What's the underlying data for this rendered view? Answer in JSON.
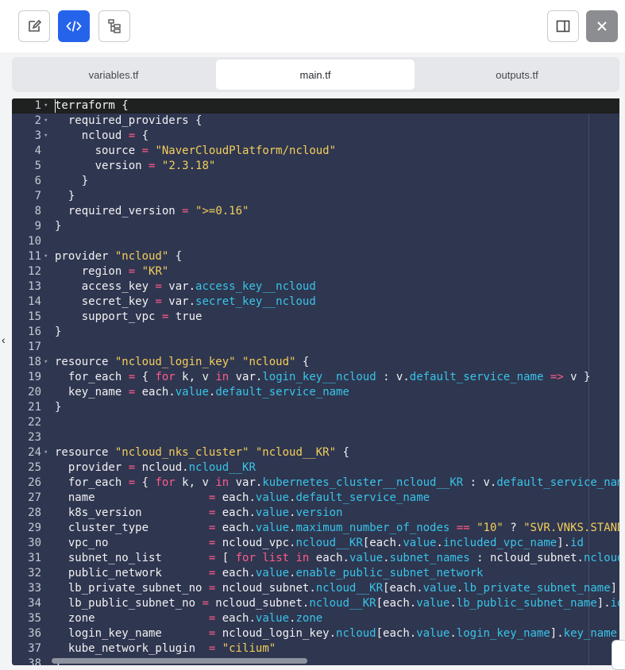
{
  "toolbar": {
    "buttons": [
      {
        "name": "edit-button",
        "icon": "edit-icon"
      },
      {
        "name": "code-view-button",
        "icon": "code-icon",
        "active": true
      },
      {
        "name": "tree-view-button",
        "icon": "tree-icon"
      }
    ],
    "right_buttons": [
      {
        "name": "toggle-panel-button",
        "icon": "sidebar-panel-icon"
      },
      {
        "name": "close-button",
        "icon": "close-icon"
      }
    ]
  },
  "tabs": [
    "variables.tf",
    "main.tf",
    "outputs.tf"
  ],
  "active_tab": "main.tf",
  "colors": {
    "accent": "#2563eb",
    "editor_bg": "#2f3650",
    "keyword": "#ff5c8a",
    "string": "#f2cf5b",
    "property": "#38c4e8"
  },
  "editor": {
    "lines": [
      {
        "n": "1",
        "fold": true,
        "tokens": [
          [
            "t",
            "terraform {"
          ]
        ]
      },
      {
        "n": "2",
        "fold": true,
        "tokens": [
          [
            "t",
            "  required_providers {"
          ]
        ]
      },
      {
        "n": "3",
        "fold": true,
        "tokens": [
          [
            "t",
            "    ncloud "
          ],
          [
            "k",
            "="
          ],
          [
            "t",
            " {"
          ]
        ]
      },
      {
        "n": "4",
        "tokens": [
          [
            "t",
            "      source "
          ],
          [
            "k",
            "="
          ],
          [
            "t",
            " "
          ],
          [
            "s",
            "\"NaverCloudPlatform/ncloud\""
          ]
        ]
      },
      {
        "n": "5",
        "tokens": [
          [
            "t",
            "      version "
          ],
          [
            "k",
            "="
          ],
          [
            "t",
            " "
          ],
          [
            "s",
            "\"2.3.18\""
          ]
        ]
      },
      {
        "n": "6",
        "tokens": [
          [
            "t",
            "    }"
          ]
        ]
      },
      {
        "n": "7",
        "tokens": [
          [
            "t",
            "  }"
          ]
        ]
      },
      {
        "n": "8",
        "tokens": [
          [
            "t",
            "  required_version "
          ],
          [
            "k",
            "="
          ],
          [
            "t",
            " "
          ],
          [
            "s",
            "\">=0.16\""
          ]
        ]
      },
      {
        "n": "9",
        "tokens": [
          [
            "t",
            "}"
          ]
        ]
      },
      {
        "n": "10",
        "tokens": [
          [
            "t",
            ""
          ]
        ]
      },
      {
        "n": "11",
        "fold": true,
        "tokens": [
          [
            "t",
            "provider "
          ],
          [
            "s",
            "\"ncloud\""
          ],
          [
            "t",
            " {"
          ]
        ]
      },
      {
        "n": "12",
        "tokens": [
          [
            "t",
            "    region "
          ],
          [
            "k",
            "="
          ],
          [
            "t",
            " "
          ],
          [
            "s",
            "\"KR\""
          ]
        ]
      },
      {
        "n": "13",
        "tokens": [
          [
            "t",
            "    access_key "
          ],
          [
            "k",
            "="
          ],
          [
            "t",
            " var."
          ],
          [
            "p",
            "access_key__ncloud"
          ]
        ]
      },
      {
        "n": "14",
        "tokens": [
          [
            "t",
            "    secret_key "
          ],
          [
            "k",
            "="
          ],
          [
            "t",
            " var."
          ],
          [
            "p",
            "secret_key__ncloud"
          ]
        ]
      },
      {
        "n": "15",
        "tokens": [
          [
            "t",
            "    support_vpc "
          ],
          [
            "k",
            "="
          ],
          [
            "t",
            " true"
          ]
        ]
      },
      {
        "n": "16",
        "tokens": [
          [
            "t",
            "}"
          ]
        ]
      },
      {
        "n": "17",
        "tokens": [
          [
            "t",
            ""
          ]
        ]
      },
      {
        "n": "18",
        "fold": true,
        "tokens": [
          [
            "t",
            "resource "
          ],
          [
            "s",
            "\"ncloud_login_key\""
          ],
          [
            "t",
            " "
          ],
          [
            "s",
            "\"ncloud\""
          ],
          [
            "t",
            " {"
          ]
        ]
      },
      {
        "n": "19",
        "tokens": [
          [
            "t",
            "  for_each "
          ],
          [
            "k",
            "="
          ],
          [
            "t",
            " { "
          ],
          [
            "k",
            "for"
          ],
          [
            "t",
            " k, v "
          ],
          [
            "k",
            "in"
          ],
          [
            "t",
            " var."
          ],
          [
            "p",
            "login_key__ncloud"
          ],
          [
            "t",
            " : v."
          ],
          [
            "p",
            "default_service_name"
          ],
          [
            "t",
            " "
          ],
          [
            "k",
            "=>"
          ],
          [
            "t",
            " v }"
          ]
        ]
      },
      {
        "n": "20",
        "tokens": [
          [
            "t",
            "  key_name "
          ],
          [
            "k",
            "="
          ],
          [
            "t",
            " each."
          ],
          [
            "p",
            "value"
          ],
          [
            "t",
            "."
          ],
          [
            "p",
            "default_service_name"
          ]
        ]
      },
      {
        "n": "21",
        "tokens": [
          [
            "t",
            "}"
          ]
        ]
      },
      {
        "n": "22",
        "tokens": [
          [
            "t",
            ""
          ]
        ]
      },
      {
        "n": "23",
        "tokens": [
          [
            "t",
            ""
          ]
        ]
      },
      {
        "n": "24",
        "fold": true,
        "tokens": [
          [
            "t",
            "resource "
          ],
          [
            "s",
            "\"ncloud_nks_cluster\""
          ],
          [
            "t",
            " "
          ],
          [
            "s",
            "\"ncloud__KR\""
          ],
          [
            "t",
            " {"
          ]
        ]
      },
      {
        "n": "25",
        "tokens": [
          [
            "t",
            "  provider "
          ],
          [
            "k",
            "="
          ],
          [
            "t",
            " ncloud."
          ],
          [
            "p",
            "ncloud__KR"
          ]
        ]
      },
      {
        "n": "26",
        "tokens": [
          [
            "t",
            "  for_each "
          ],
          [
            "k",
            "="
          ],
          [
            "t",
            " { "
          ],
          [
            "k",
            "for"
          ],
          [
            "t",
            " k, v "
          ],
          [
            "k",
            "in"
          ],
          [
            "t",
            " var."
          ],
          [
            "p",
            "kubernetes_cluster__ncloud__KR"
          ],
          [
            "t",
            " : v."
          ],
          [
            "p",
            "default_service_name"
          ]
        ]
      },
      {
        "n": "27",
        "tokens": [
          [
            "t",
            "  name                 "
          ],
          [
            "k",
            "="
          ],
          [
            "t",
            " each."
          ],
          [
            "p",
            "value"
          ],
          [
            "t",
            "."
          ],
          [
            "p",
            "default_service_name"
          ]
        ]
      },
      {
        "n": "28",
        "tokens": [
          [
            "t",
            "  k8s_version          "
          ],
          [
            "k",
            "="
          ],
          [
            "t",
            " each."
          ],
          [
            "p",
            "value"
          ],
          [
            "t",
            "."
          ],
          [
            "p",
            "version"
          ]
        ]
      },
      {
        "n": "29",
        "tokens": [
          [
            "t",
            "  cluster_type         "
          ],
          [
            "k",
            "="
          ],
          [
            "t",
            " each."
          ],
          [
            "p",
            "value"
          ],
          [
            "t",
            "."
          ],
          [
            "p",
            "maximum_number_of_nodes"
          ],
          [
            "t",
            " "
          ],
          [
            "k",
            "=="
          ],
          [
            "t",
            " "
          ],
          [
            "s",
            "\"10\""
          ],
          [
            "t",
            " ? "
          ],
          [
            "s",
            "\"SVR.VNKS.STANDARD\""
          ]
        ]
      },
      {
        "n": "30",
        "tokens": [
          [
            "t",
            "  vpc_no               "
          ],
          [
            "k",
            "="
          ],
          [
            "t",
            " ncloud_vpc."
          ],
          [
            "p",
            "ncloud__KR"
          ],
          [
            "t",
            "[each."
          ],
          [
            "p",
            "value"
          ],
          [
            "t",
            "."
          ],
          [
            "p",
            "included_vpc_name"
          ],
          [
            "t",
            "]."
          ],
          [
            "p",
            "id"
          ]
        ]
      },
      {
        "n": "31",
        "tokens": [
          [
            "t",
            "  subnet_no_list       "
          ],
          [
            "k",
            "="
          ],
          [
            "t",
            " [ "
          ],
          [
            "k",
            "for"
          ],
          [
            "t",
            " "
          ],
          [
            "k",
            "list"
          ],
          [
            "t",
            " "
          ],
          [
            "k",
            "in"
          ],
          [
            "t",
            " each."
          ],
          [
            "p",
            "value"
          ],
          [
            "t",
            "."
          ],
          [
            "p",
            "subnet_names"
          ],
          [
            "t",
            " : ncloud_subnet."
          ],
          [
            "p",
            "ncloud__KR"
          ]
        ]
      },
      {
        "n": "32",
        "tokens": [
          [
            "t",
            "  public_network       "
          ],
          [
            "k",
            "="
          ],
          [
            "t",
            " each."
          ],
          [
            "p",
            "value"
          ],
          [
            "t",
            "."
          ],
          [
            "p",
            "enable_public_subnet_network"
          ]
        ]
      },
      {
        "n": "33",
        "tokens": [
          [
            "t",
            "  lb_private_subnet_no "
          ],
          [
            "k",
            "="
          ],
          [
            "t",
            " ncloud_subnet."
          ],
          [
            "p",
            "ncloud__KR"
          ],
          [
            "t",
            "[each."
          ],
          [
            "p",
            "value"
          ],
          [
            "t",
            "."
          ],
          [
            "p",
            "lb_private_subnet_name"
          ],
          [
            "t",
            "]."
          ],
          [
            "p",
            "id"
          ]
        ]
      },
      {
        "n": "34",
        "tokens": [
          [
            "t",
            "  lb_public_subnet_no "
          ],
          [
            "k",
            "="
          ],
          [
            "t",
            " ncloud_subnet."
          ],
          [
            "p",
            "ncloud__KR"
          ],
          [
            "t",
            "[each."
          ],
          [
            "p",
            "value"
          ],
          [
            "t",
            "."
          ],
          [
            "p",
            "lb_public_subnet_name"
          ],
          [
            "t",
            "]."
          ],
          [
            "p",
            "id"
          ]
        ]
      },
      {
        "n": "35",
        "tokens": [
          [
            "t",
            "  zone                 "
          ],
          [
            "k",
            "="
          ],
          [
            "t",
            " each."
          ],
          [
            "p",
            "value"
          ],
          [
            "t",
            "."
          ],
          [
            "p",
            "zone"
          ]
        ]
      },
      {
        "n": "36",
        "tokens": [
          [
            "t",
            "  login_key_name       "
          ],
          [
            "k",
            "="
          ],
          [
            "t",
            " ncloud_login_key."
          ],
          [
            "p",
            "ncloud"
          ],
          [
            "t",
            "[each."
          ],
          [
            "p",
            "value"
          ],
          [
            "t",
            "."
          ],
          [
            "p",
            "login_key_name"
          ],
          [
            "t",
            "]."
          ],
          [
            "p",
            "key_name"
          ]
        ]
      },
      {
        "n": "37",
        "tokens": [
          [
            "t",
            "  kube_network_plugin  "
          ],
          [
            "k",
            "="
          ],
          [
            "t",
            " "
          ],
          [
            "s",
            "\"cilium\""
          ]
        ]
      },
      {
        "n": "38",
        "tokens": [
          [
            "t",
            "}"
          ]
        ]
      }
    ]
  }
}
